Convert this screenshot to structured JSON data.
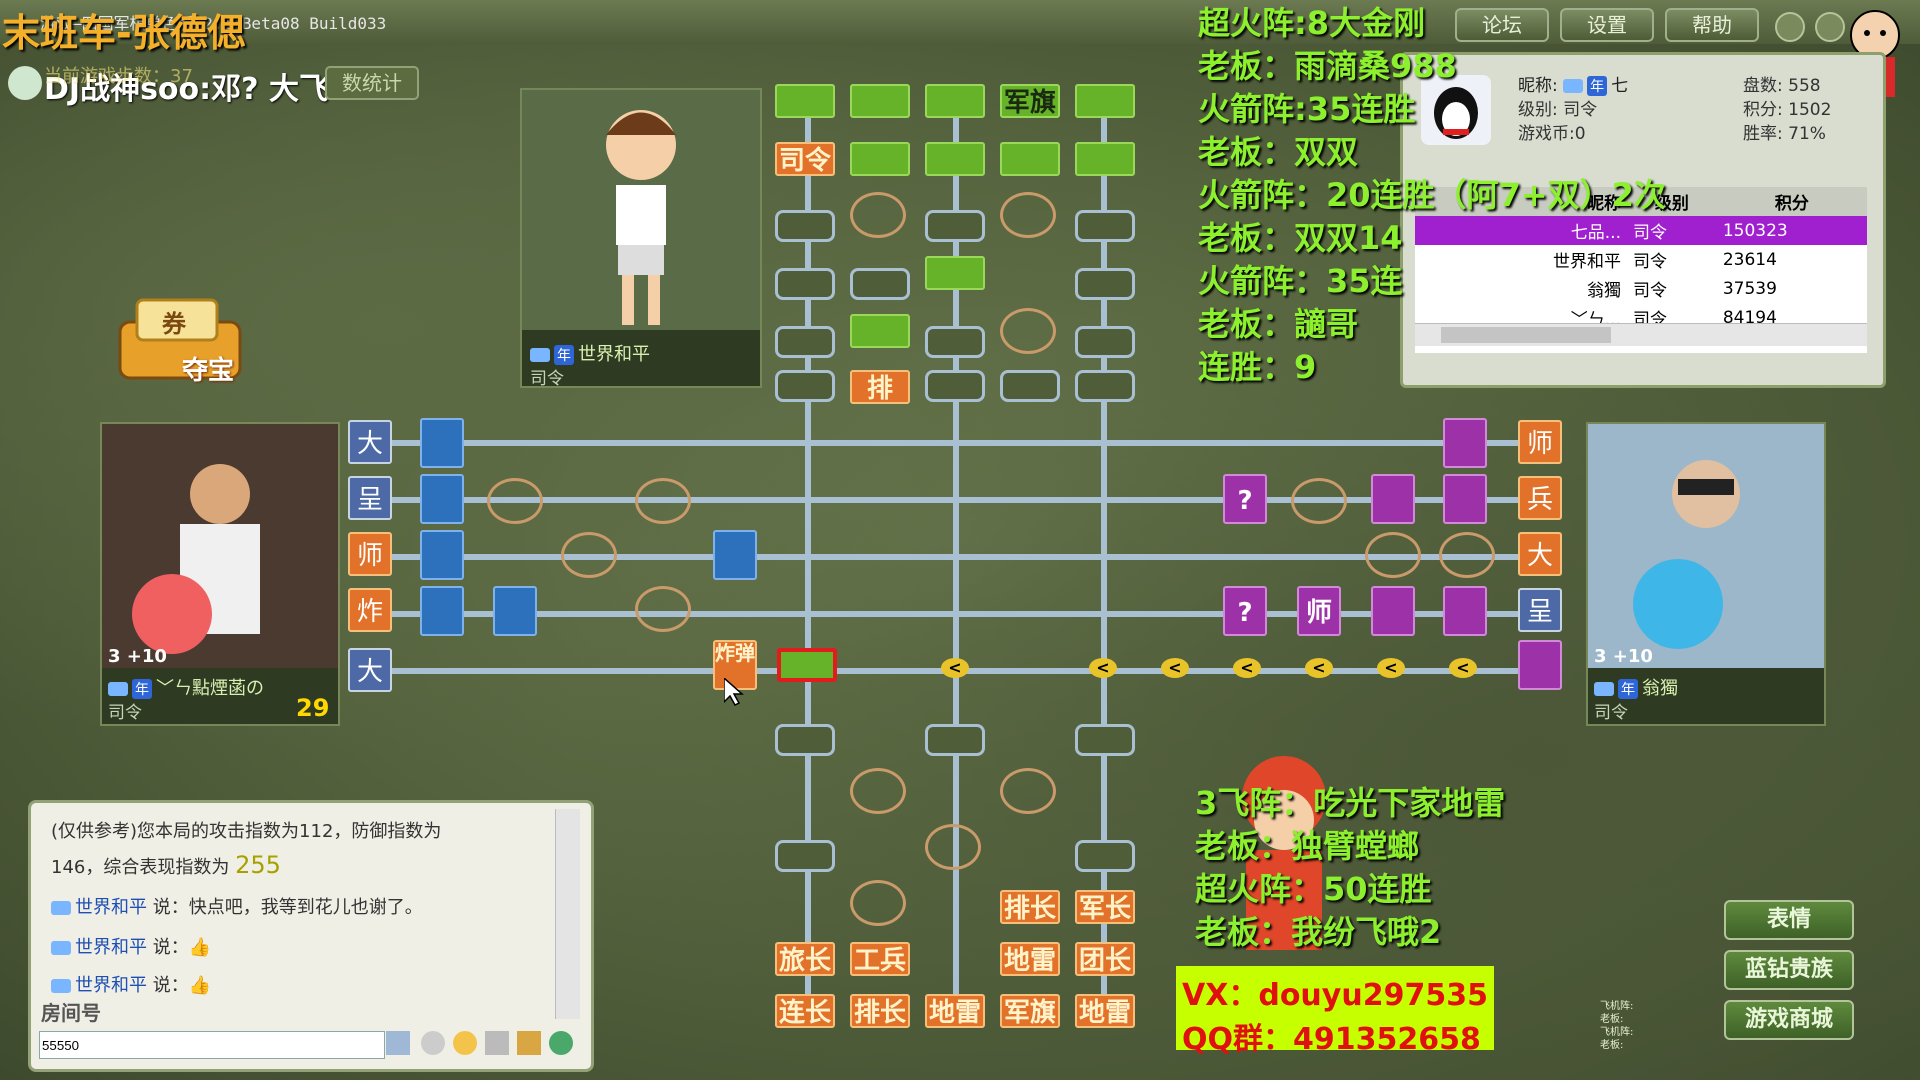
{
  "window": {
    "title": "游戏—四国军棋单色版 2.1 Beta08 Build033",
    "overlay_title": "末班车-张德偲",
    "top_buttons": [
      "论坛",
      "设置",
      "帮助"
    ]
  },
  "top_left": {
    "streamer_tag": "DJ战神soo:邓?  大飞",
    "step_text": "当前游戏步数：37",
    "stats_button": "数统计"
  },
  "overlay_right": {
    "lines": [
      "超火阵:8大金刚",
      "老板：雨滴桑988",
      "火箭阵:35连胜",
      "老板：双双",
      "火箭阵：20连胜（阿7+双）2次",
      "老板：双双14",
      "火箭阵：35连",
      "老板：讁哥",
      "连胜：9"
    ]
  },
  "overlay_bottom": {
    "lines": [
      "3飞阵：吃光下家地雷",
      "老板：独臂螳螂",
      "超火阵：50连胜",
      "老板：我纷飞哦2"
    ],
    "vx": "VX：douyu297535",
    "qq": "QQ群：491352658"
  },
  "treasure": {
    "label": "夺宝",
    "ticket": "券"
  },
  "players": {
    "top": {
      "name": "世界和平",
      "rank": "司令",
      "badge": "年"
    },
    "left": {
      "name": "﹀ㄣ點煙菡の",
      "rank": "司令",
      "badge": "年",
      "level": "3 +10",
      "number": "29"
    },
    "right": {
      "name": "翁獨",
      "rank": "司令",
      "badge": "年",
      "level": "3 +10"
    }
  },
  "stats": {
    "nickname_label": "昵称:",
    "nickname_value": "七",
    "level_label": "级别:",
    "level_value": "司令",
    "coins_label": "游戏币:",
    "coins_value": "0",
    "games_label": "盘数:",
    "games_value": "558",
    "score_label": "积分:",
    "score_value": "1502",
    "winrate_label": "胜率:",
    "winrate_value": "71%",
    "badge": "年",
    "columns": [
      "昵称",
      "级别",
      "积分"
    ],
    "rows": [
      {
        "name": "七品...",
        "rank": "司令",
        "score": "150323"
      },
      {
        "name": "世界和平",
        "rank": "司令",
        "score": "23614"
      },
      {
        "name": "翁獨",
        "rank": "司令",
        "score": "37539"
      },
      {
        "name": "﹀ㄣ...",
        "rank": "司令",
        "score": "84194"
      }
    ]
  },
  "board": {
    "top_pieces": [
      "军旗",
      "司令",
      "排"
    ],
    "bottom_pieces": [
      "排长",
      "军长",
      "旅长",
      "工兵",
      "地雷",
      "团长",
      "连长",
      "排长",
      "地雷",
      "军旗",
      "地雷"
    ],
    "left_labels": [
      "大",
      "呈",
      "师",
      "炸",
      "大"
    ],
    "right_labels": [
      "师",
      "兵",
      "大",
      "呈"
    ],
    "purple_pieces": [
      "?",
      "?",
      "师"
    ],
    "orange_special": "炸弹"
  },
  "chat": {
    "system_line1": "(仅供参考)您本局的攻击指数为112，防御指数为",
    "system_line2": "146，综合表现指数为",
    "system_score": "255",
    "msgs": [
      {
        "name": "世界和平",
        "said": "说：",
        "text": "快点吧，我等到花儿也谢了。"
      },
      {
        "name": "世界和平",
        "said": "说：",
        "text": "👍"
      },
      {
        "name": "世界和平",
        "said": "说：",
        "text": "👍"
      }
    ],
    "room_label": "房间号",
    "input_value": "55550"
  },
  "right_buttons": [
    "表情",
    "蓝钻贵族",
    "游戏商城"
  ],
  "tiny_notes": [
    "飞机阵:",
    "老板:",
    "飞机阵:",
    "老板:"
  ]
}
